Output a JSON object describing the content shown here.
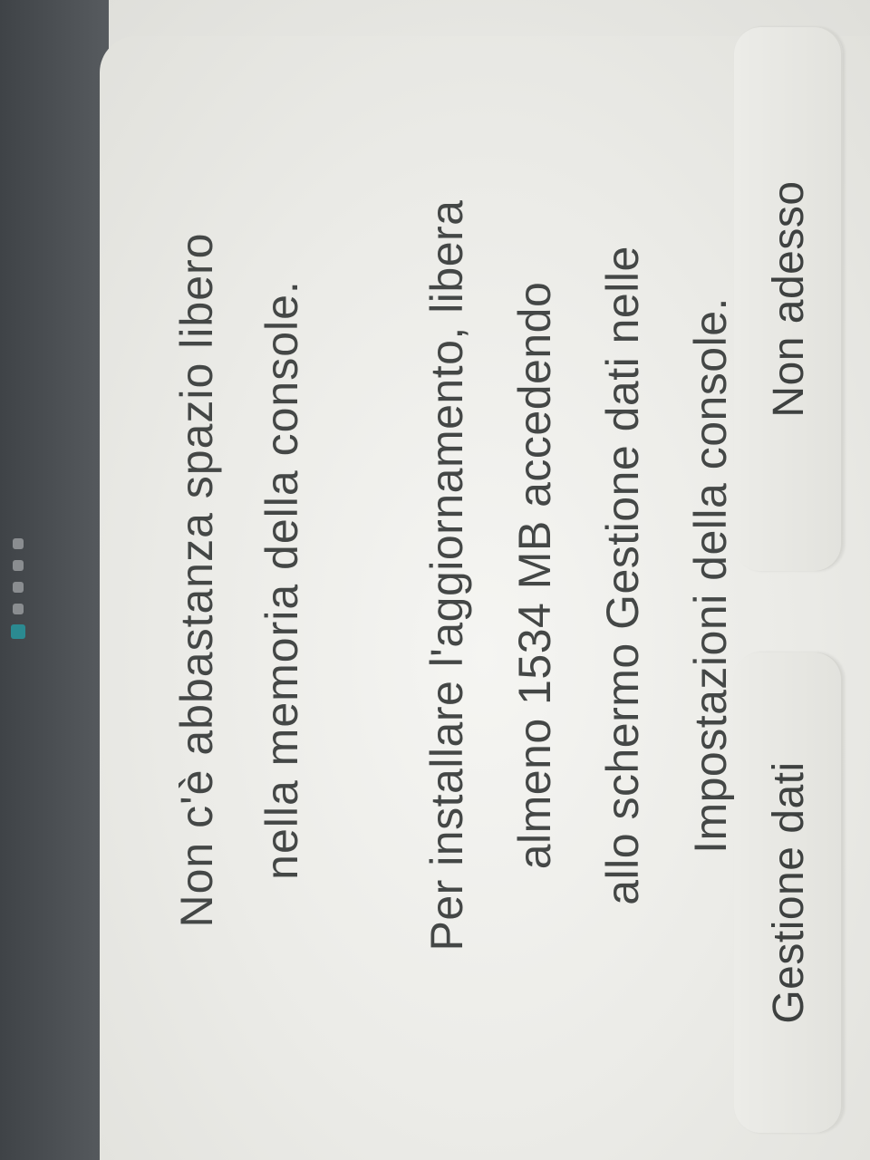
{
  "dialog": {
    "title_lines": [
      "Non c'è abbastanza spazio libero",
      "nella memoria della console."
    ],
    "body_lines": [
      "Per installare l'aggiornamento, libera",
      "almeno 1534 MB accedendo",
      "allo schermo Gestione dati nelle",
      "Impostazioni della console."
    ]
  },
  "buttons": {
    "not_now": "Non adesso",
    "data_management": "Gestione dati"
  },
  "page_indicator": {
    "total": 5,
    "active_index": 0
  },
  "colors": {
    "dialog_background": "#ececE8",
    "text": "#444746",
    "indicator_active": "#2b8a91",
    "indicator_inactive": "#8a8d90"
  }
}
